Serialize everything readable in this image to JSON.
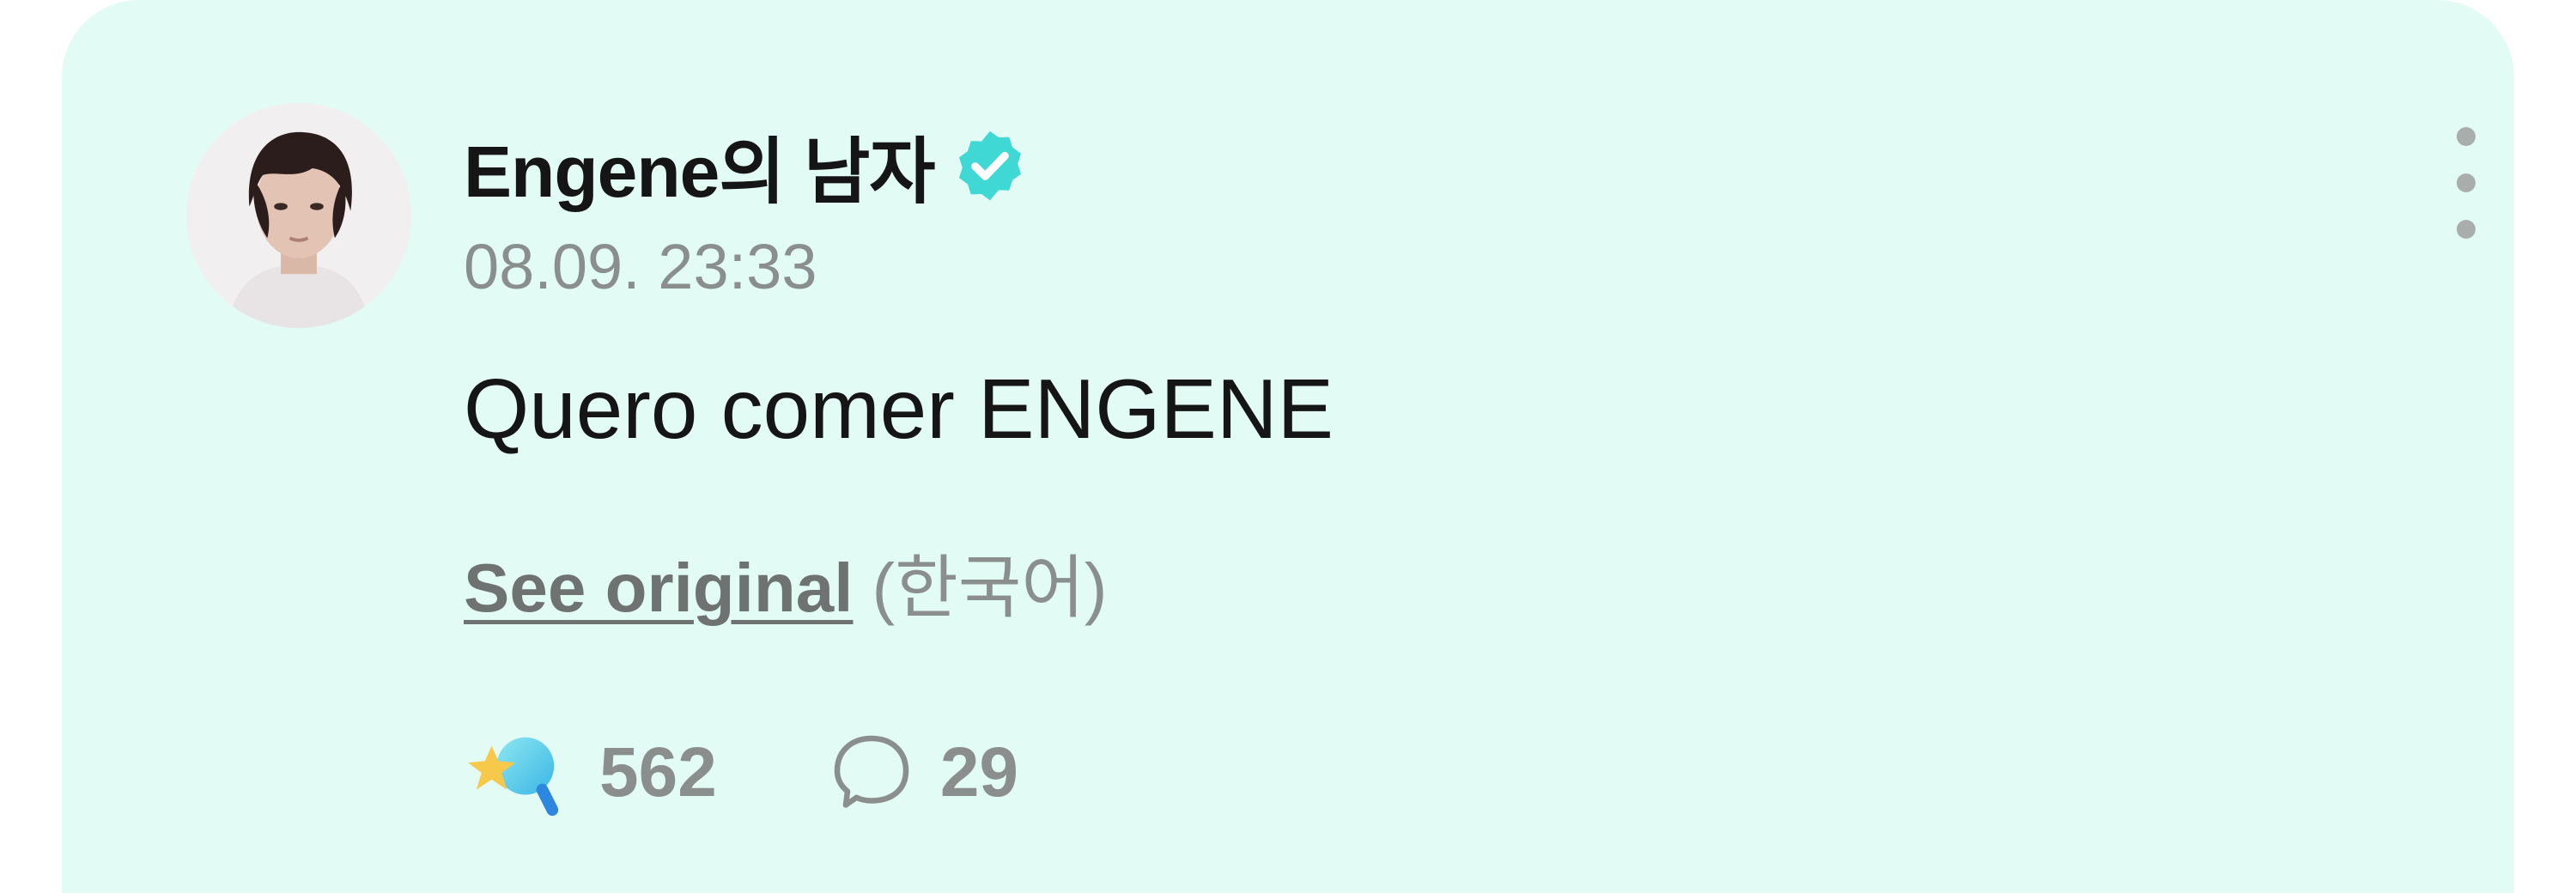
{
  "post": {
    "author": {
      "name": "Engene의 남자",
      "verified_icon": "verified-badge-icon",
      "verified_color": "#3fd8d4"
    },
    "timestamp": "08.09. 23:33",
    "text": "Quero comer ENGENE",
    "translation": {
      "see_original_label": "See original",
      "language": "(한국어)"
    },
    "reactions": {
      "icon": "star-reaction-icon",
      "count": "562"
    },
    "comments": {
      "icon": "speech-bubble-icon",
      "count": "29"
    },
    "menu_icon": "more-vertical-icon"
  },
  "colors": {
    "card_background": "#e3fbf5",
    "text_primary": "#151515",
    "text_secondary": "#8a8f8e",
    "accent": "#3fd8d4"
  }
}
